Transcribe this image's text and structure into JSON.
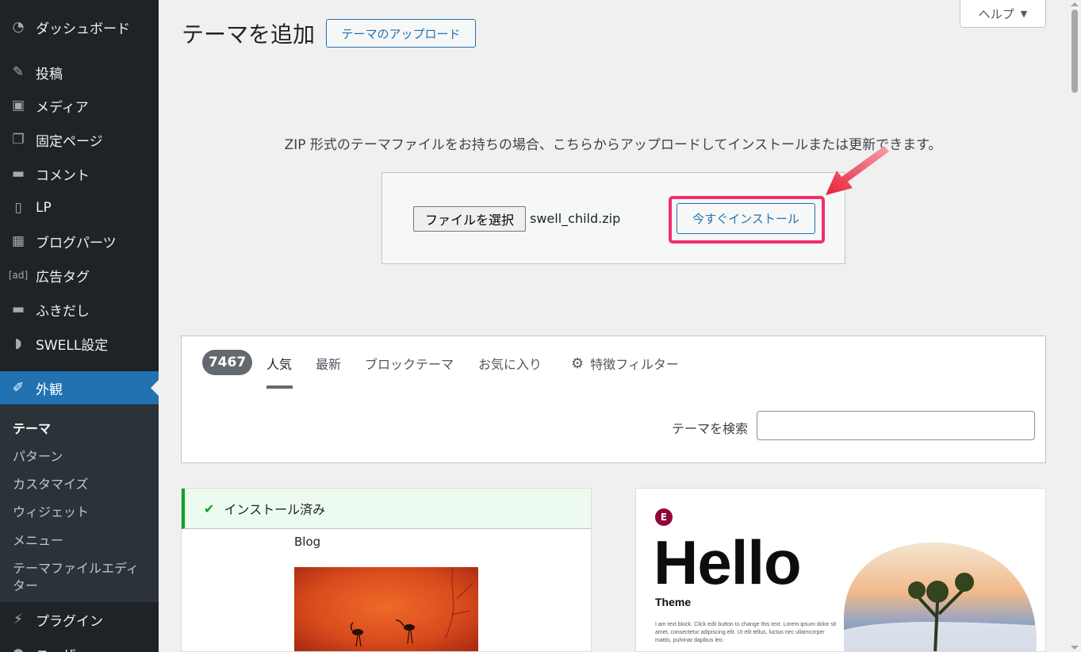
{
  "sidebar": {
    "items": [
      {
        "id": "dashboard",
        "label": "ダッシュボード",
        "icon": "dashboard-icon",
        "glyph": "◔"
      },
      {
        "id": "posts",
        "label": "投稿",
        "icon": "pin-icon",
        "glyph": "✎"
      },
      {
        "id": "media",
        "label": "メディア",
        "icon": "media-icon",
        "glyph": "▣"
      },
      {
        "id": "pages",
        "label": "固定ページ",
        "icon": "pages-icon",
        "glyph": "❐"
      },
      {
        "id": "comments",
        "label": "コメント",
        "icon": "comment-icon",
        "glyph": "▬"
      },
      {
        "id": "lp",
        "label": "LP",
        "icon": "document-icon",
        "glyph": "▯"
      },
      {
        "id": "blog-parts",
        "label": "ブログパーツ",
        "icon": "grid-icon",
        "glyph": "▦"
      },
      {
        "id": "ad-tags",
        "label": "広告タグ",
        "icon": "ad-icon",
        "glyph": "[ad]"
      },
      {
        "id": "balloon",
        "label": "ふきだし",
        "icon": "balloon-icon",
        "glyph": "▬"
      },
      {
        "id": "swell",
        "label": "SWELL設定",
        "icon": "swell-icon",
        "glyph": "◗"
      },
      {
        "id": "appearance",
        "label": "外観",
        "icon": "brush-icon",
        "glyph": "✐"
      },
      {
        "id": "plugins",
        "label": "プラグイン",
        "icon": "plugin-icon",
        "glyph": "⚡"
      },
      {
        "id": "users",
        "label": "ユーザー",
        "icon": "user-icon",
        "glyph": "●"
      }
    ],
    "submenu": [
      {
        "id": "themes",
        "label": "テーマ"
      },
      {
        "id": "patterns",
        "label": "パターン"
      },
      {
        "id": "customize",
        "label": "カスタマイズ"
      },
      {
        "id": "widgets",
        "label": "ウィジェット"
      },
      {
        "id": "menus",
        "label": "メニュー"
      },
      {
        "id": "theme-editor-1",
        "label": "テーマファイルエディ"
      },
      {
        "id": "theme-editor-2",
        "label": "ター"
      }
    ]
  },
  "header": {
    "title": "テーマを追加",
    "upload_button": "テーマのアップロード",
    "help_button": "ヘルプ",
    "help_caret": "▼"
  },
  "upload": {
    "description": "ZIP 形式のテーマファイルをお持ちの場合、こちらからアップロードしてインストールまたは更新できます。",
    "file_select_button": "ファイルを選択",
    "file_name": "swell_child.zip",
    "install_button": "今すぐインストール"
  },
  "filters": {
    "count": "7467",
    "tabs": [
      "人気",
      "最新",
      "ブロックテーマ",
      "お気に入り"
    ],
    "feature_filter": "特徴フィルター",
    "search_label": "テーマを検索",
    "search_value": ""
  },
  "themes": {
    "installed_notice": "インストール済み",
    "installed_check": "✔",
    "blog_label": "Blog",
    "hello": {
      "logo": "E",
      "title": "Hello",
      "subtitle": "Theme",
      "body": "I am text block. Click edit button to change this text. Lorem ipsum dolor sit amet, consectetur adipiscing elit. Ut elit tellus, luctus nec ullamcorper mattis, pulvinar dapibus leo."
    }
  },
  "colors": {
    "sidebar_bg": "#1d2327",
    "accent": "#2271b1",
    "highlight": "#f0306e",
    "installed_green": "#00a32a"
  }
}
